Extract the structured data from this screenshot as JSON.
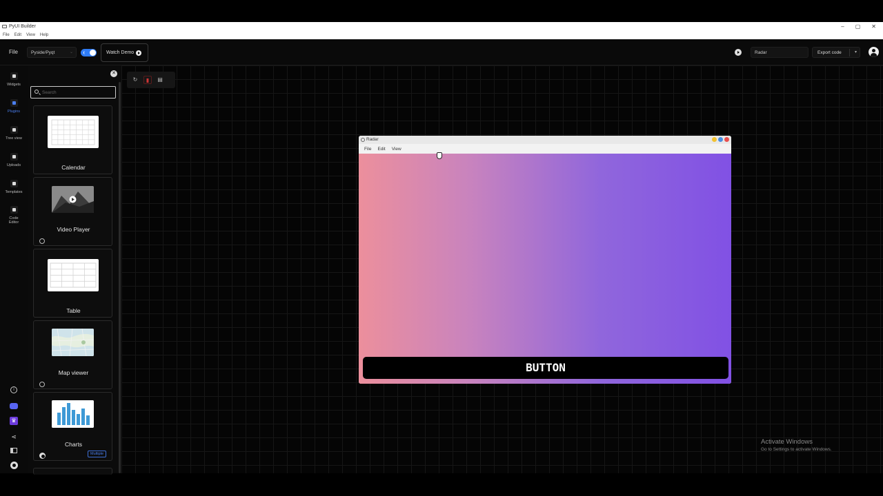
{
  "window": {
    "title": "PyUI Builder",
    "controls": [
      "–",
      "▢",
      "✕"
    ]
  },
  "os_menu": [
    "File",
    "Edit",
    "View",
    "Help"
  ],
  "toolbar": {
    "file": "File",
    "framework": "Pyside/Pyqt",
    "watch_demo": "Watch Demo",
    "project_name": "Radar",
    "export": "Export code"
  },
  "rail": {
    "items": [
      {
        "label": "Widgets",
        "active": false
      },
      {
        "label": "Plugins",
        "active": true
      },
      {
        "label": "Tree view",
        "active": false
      },
      {
        "label": "Uploads",
        "active": false
      },
      {
        "label": "Templates",
        "active": false
      },
      {
        "label": "Code Editor",
        "active": false
      }
    ],
    "bottom_icons": [
      "info-icon",
      "discord-icon",
      "premium-crown-icon",
      "share-icon",
      "docs-book-icon",
      "github-icon"
    ]
  },
  "plugins": {
    "search_placeholder": "Search",
    "cards": [
      {
        "label": "Calendar",
        "badge": ""
      },
      {
        "label": "Video Player",
        "badge": ""
      },
      {
        "label": "Table",
        "badge": ""
      },
      {
        "label": "Map viewer",
        "badge": ""
      },
      {
        "label": "Charts",
        "badge": "Multiple"
      }
    ]
  },
  "preview": {
    "title": "Radar",
    "menu": [
      "File",
      "Edit",
      "View"
    ],
    "button": "BUTTON",
    "colors": {
      "gradient_start": "#ec8f9c",
      "gradient_end": "#8151e4"
    }
  },
  "watermark": {
    "line1": "Activate Windows",
    "line2": "Go to Settings to activate Windows."
  },
  "colors": {
    "accent": "#4b7ff0",
    "toggle": "#2f7cf6",
    "delete": "#d03535"
  }
}
